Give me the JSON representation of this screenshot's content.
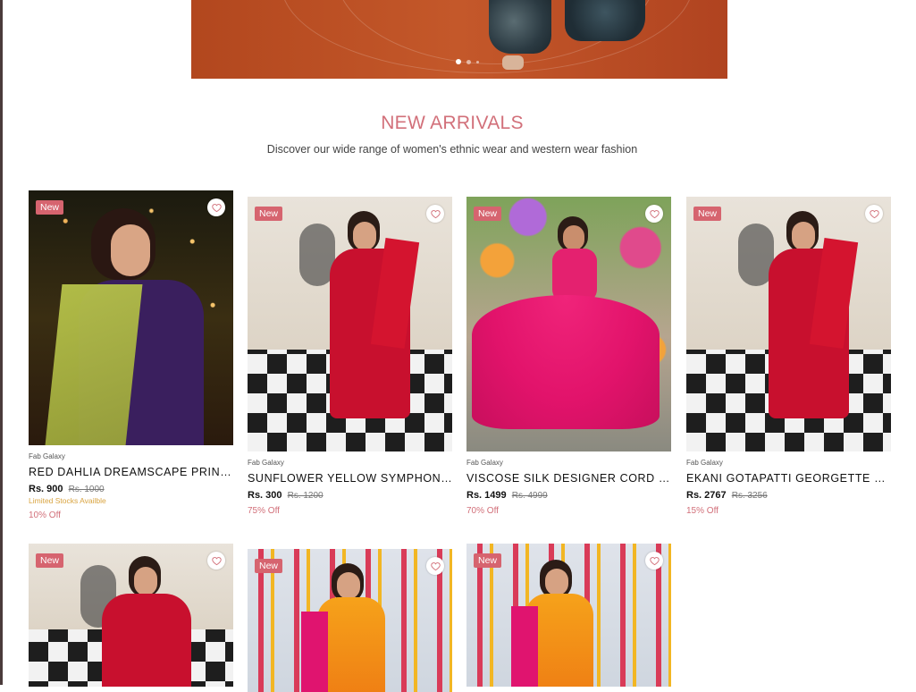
{
  "hero": {
    "slides": 3,
    "active_slide": 1
  },
  "section": {
    "title": "NEW ARRIVALS",
    "subtitle": "Discover our wide range of women's ethnic wear and western wear fashion"
  },
  "colors": {
    "accent": "#d2707a",
    "badge": "#d6646f",
    "stock_warning": "#d9a441"
  },
  "products": [
    {
      "badge": "New",
      "brand": "Fab Galaxy",
      "name": "RED DAHLIA DREAMSCAPE PRINT...",
      "price": "Rs. 900",
      "mrp": "Rs. 1000",
      "stock_note": "Limited Stocks Availble",
      "discount": "10% Off",
      "icon": "heart-icon"
    },
    {
      "badge": "New",
      "brand": "Fab Galaxy",
      "name": "SUNFLOWER YELLOW SYMPHONY ...",
      "price": "Rs. 300",
      "mrp": "Rs. 1200",
      "discount": "75% Off",
      "icon": "heart-icon"
    },
    {
      "badge": "New",
      "brand": "Fab Galaxy",
      "name": "VISCOSE SILK DESIGNER CORD SE...",
      "price": "Rs. 1499",
      "mrp": "Rs. 4999",
      "discount": "70% Off",
      "icon": "heart-icon"
    },
    {
      "badge": "New",
      "brand": "Fab Galaxy",
      "name": "EKANI GOTAPATTI GEORGETTE SUI...",
      "price": "Rs. 2767",
      "mrp": "Rs. 3256",
      "discount": "15% Off",
      "icon": "heart-icon"
    },
    {
      "badge": "New",
      "icon": "heart-icon"
    },
    {
      "badge": "New",
      "icon": "heart-icon"
    },
    {
      "badge": "New",
      "icon": "heart-icon"
    }
  ]
}
